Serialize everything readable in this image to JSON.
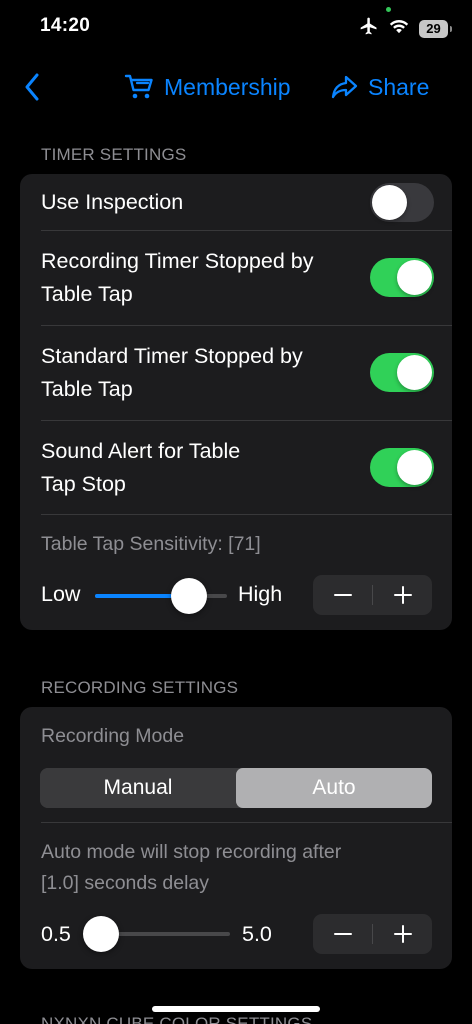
{
  "status_bar": {
    "time": "14:20",
    "battery": "29",
    "icons": [
      "airplane-icon",
      "wifi-icon",
      "battery-icon"
    ]
  },
  "nav": {
    "back_icon": "chevron-left-icon",
    "membership_label": "Membership",
    "membership_icon": "cart-icon",
    "share_label": "Share",
    "share_icon": "share-arrow-icon"
  },
  "timer_settings": {
    "header": "TIMER SETTINGS",
    "rows": [
      {
        "label": "Use Inspection",
        "on": false
      },
      {
        "label_line1": "Recording Timer Stopped by",
        "label_line2": "Table Tap",
        "on": true
      },
      {
        "label_line1": "Standard Timer Stopped by",
        "label_line2": "Table Tap",
        "on": true
      },
      {
        "label_line1": "Sound Alert for Table",
        "label_line2": "Tap Stop",
        "on": true
      }
    ],
    "sensitivity_caption": "Table Tap Sensitivity: [71]",
    "slider_low": "Low",
    "slider_high": "High",
    "sensitivity_value": 71,
    "sensitivity_min": 0,
    "sensitivity_max": 100
  },
  "recording_settings": {
    "header": "RECORDING SETTINGS",
    "mode_caption": "Recording Mode",
    "segments": [
      "Manual",
      "Auto"
    ],
    "selected_segment": "Auto",
    "delay_caption_line1": "Auto mode will stop recording after",
    "delay_caption_line2": "[1.0] seconds delay",
    "slider_min_label": "0.5",
    "slider_max_label": "5.0",
    "delay_value": 1.0,
    "delay_min": 0.5,
    "delay_max": 5.0
  },
  "next_section_header": "NXNXN CUBE COLOR SETTINGS",
  "colors": {
    "accent": "#0a84ff",
    "toggle_on": "#30d158",
    "card": "#1c1c1e",
    "background": "#000000"
  }
}
